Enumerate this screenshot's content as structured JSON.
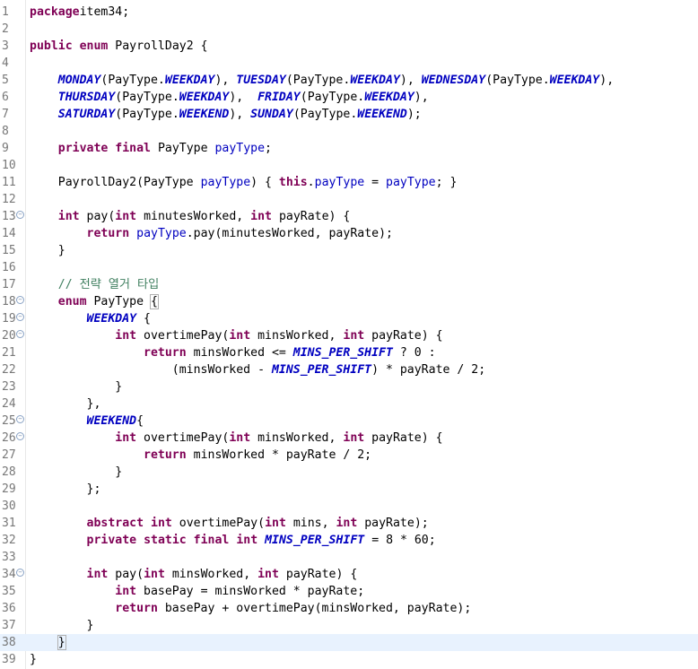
{
  "editor": {
    "language": "java",
    "current_line": 38,
    "colors": {
      "keyword": "#7f0055",
      "constant": "#0000c0",
      "field": "#0000c0",
      "comment": "#3f7f5f",
      "line_number": "#787878",
      "current_line_bg": "#e8f2fe"
    },
    "folding_markers_on_lines": [
      13,
      18,
      19,
      20,
      25,
      26,
      34
    ],
    "lines": [
      {
        "n": "1",
        "tokens": [
          [
            "kw",
            "package"
          ],
          [
            "",
            "item34;"
          ]
        ]
      },
      {
        "n": "2",
        "tokens": []
      },
      {
        "n": "3",
        "tokens": [
          [
            "kw",
            "public"
          ],
          [
            "",
            " "
          ],
          [
            "kw",
            "enum"
          ],
          [
            "",
            " PayrollDay2 {"
          ]
        ]
      },
      {
        "n": "4",
        "tokens": []
      },
      {
        "n": "5",
        "tokens": [
          [
            "",
            "    "
          ],
          [
            "cst",
            "MONDAY"
          ],
          [
            "",
            "(PayType."
          ],
          [
            "cst",
            "WEEKDAY"
          ],
          [
            "",
            "), "
          ],
          [
            "cst",
            "TUESDAY"
          ],
          [
            "",
            "(PayType."
          ],
          [
            "cst",
            "WEEKDAY"
          ],
          [
            "",
            "), "
          ],
          [
            "cst",
            "WEDNESDAY"
          ],
          [
            "",
            "(PayType."
          ],
          [
            "cst",
            "WEEKDAY"
          ],
          [
            "",
            "),"
          ]
        ]
      },
      {
        "n": "6",
        "tokens": [
          [
            "",
            "    "
          ],
          [
            "cst",
            "THURSDAY"
          ],
          [
            "",
            "(PayType."
          ],
          [
            "cst",
            "WEEKDAY"
          ],
          [
            "",
            "),  "
          ],
          [
            "cst",
            "FRIDAY"
          ],
          [
            "",
            "(PayType."
          ],
          [
            "cst",
            "WEEKDAY"
          ],
          [
            "",
            "),"
          ]
        ]
      },
      {
        "n": "7",
        "tokens": [
          [
            "",
            "    "
          ],
          [
            "cst",
            "SATURDAY"
          ],
          [
            "",
            "(PayType."
          ],
          [
            "cst",
            "WEEKEND"
          ],
          [
            "",
            "), "
          ],
          [
            "cst",
            "SUNDAY"
          ],
          [
            "",
            "(PayType."
          ],
          [
            "cst",
            "WEEKEND"
          ],
          [
            "",
            ");"
          ]
        ]
      },
      {
        "n": "8",
        "tokens": []
      },
      {
        "n": "9",
        "tokens": [
          [
            "",
            "    "
          ],
          [
            "kw",
            "private"
          ],
          [
            "",
            " "
          ],
          [
            "kw",
            "final"
          ],
          [
            "",
            " PayType "
          ],
          [
            "fld",
            "payType"
          ],
          [
            "",
            ";"
          ]
        ]
      },
      {
        "n": "10",
        "tokens": []
      },
      {
        "n": "11",
        "tokens": [
          [
            "",
            "    PayrollDay2(PayType "
          ],
          [
            "fld",
            "payType"
          ],
          [
            "",
            ") { "
          ],
          [
            "kw",
            "this"
          ],
          [
            "",
            "."
          ],
          [
            "fld",
            "payType"
          ],
          [
            "",
            " = "
          ],
          [
            "fld",
            "payType"
          ],
          [
            "",
            "; }"
          ]
        ]
      },
      {
        "n": "12",
        "tokens": []
      },
      {
        "n": "13",
        "tokens": [
          [
            "",
            "    "
          ],
          [
            "kw",
            "int"
          ],
          [
            "",
            " pay("
          ],
          [
            "kw",
            "int"
          ],
          [
            "",
            " minutesWorked, "
          ],
          [
            "kw",
            "int"
          ],
          [
            "",
            " payRate) {"
          ]
        ]
      },
      {
        "n": "14",
        "tokens": [
          [
            "",
            "        "
          ],
          [
            "kw",
            "return"
          ],
          [
            "",
            " "
          ],
          [
            "fld",
            "payType"
          ],
          [
            "",
            ".pay(minutesWorked, payRate);"
          ]
        ]
      },
      {
        "n": "15",
        "tokens": [
          [
            "",
            "    }"
          ]
        ]
      },
      {
        "n": "16",
        "tokens": []
      },
      {
        "n": "17",
        "tokens": [
          [
            "",
            "    "
          ],
          [
            "cmt",
            "// 전략 열거 타입"
          ]
        ]
      },
      {
        "n": "18",
        "tokens": [
          [
            "",
            "    "
          ],
          [
            "kw",
            "enum"
          ],
          [
            "",
            " PayType "
          ],
          [
            "br",
            "{"
          ]
        ]
      },
      {
        "n": "19",
        "tokens": [
          [
            "",
            "        "
          ],
          [
            "cst",
            "WEEKDAY"
          ],
          [
            "",
            " {"
          ]
        ]
      },
      {
        "n": "20",
        "tokens": [
          [
            "",
            "            "
          ],
          [
            "kw",
            "int"
          ],
          [
            "",
            " overtimePay("
          ],
          [
            "kw",
            "int"
          ],
          [
            "",
            " minsWorked, "
          ],
          [
            "kw",
            "int"
          ],
          [
            "",
            " payRate) {"
          ]
        ]
      },
      {
        "n": "21",
        "tokens": [
          [
            "",
            "                "
          ],
          [
            "kw",
            "return"
          ],
          [
            "",
            " minsWorked <= "
          ],
          [
            "cst",
            "MINS_PER_SHIFT"
          ],
          [
            "",
            " ? 0 :"
          ]
        ]
      },
      {
        "n": "22",
        "tokens": [
          [
            "",
            "                    (minsWorked - "
          ],
          [
            "cst",
            "MINS_PER_SHIFT"
          ],
          [
            "",
            ") * payRate / 2;"
          ]
        ]
      },
      {
        "n": "23",
        "tokens": [
          [
            "",
            "            }"
          ]
        ]
      },
      {
        "n": "24",
        "tokens": [
          [
            "",
            "        },"
          ]
        ]
      },
      {
        "n": "25",
        "tokens": [
          [
            "",
            "        "
          ],
          [
            "cst",
            "WEEKEND"
          ],
          [
            "",
            "{"
          ]
        ]
      },
      {
        "n": "26",
        "tokens": [
          [
            "",
            "            "
          ],
          [
            "kw",
            "int"
          ],
          [
            "",
            " overtimePay("
          ],
          [
            "kw",
            "int"
          ],
          [
            "",
            " minsWorked, "
          ],
          [
            "kw",
            "int"
          ],
          [
            "",
            " payRate) {"
          ]
        ]
      },
      {
        "n": "27",
        "tokens": [
          [
            "",
            "                "
          ],
          [
            "kw",
            "return"
          ],
          [
            "",
            " minsWorked * payRate / 2;"
          ]
        ]
      },
      {
        "n": "28",
        "tokens": [
          [
            "",
            "            }"
          ]
        ]
      },
      {
        "n": "29",
        "tokens": [
          [
            "",
            "        };"
          ]
        ]
      },
      {
        "n": "30",
        "tokens": []
      },
      {
        "n": "31",
        "tokens": [
          [
            "",
            "        "
          ],
          [
            "kw",
            "abstract"
          ],
          [
            "",
            " "
          ],
          [
            "kw",
            "int"
          ],
          [
            "",
            " overtimePay("
          ],
          [
            "kw",
            "int"
          ],
          [
            "",
            " mins, "
          ],
          [
            "kw",
            "int"
          ],
          [
            "",
            " payRate);"
          ]
        ]
      },
      {
        "n": "32",
        "tokens": [
          [
            "",
            "        "
          ],
          [
            "kw",
            "private"
          ],
          [
            "",
            " "
          ],
          [
            "kw",
            "static"
          ],
          [
            "",
            " "
          ],
          [
            "kw",
            "final"
          ],
          [
            "",
            " "
          ],
          [
            "kw",
            "int"
          ],
          [
            "",
            " "
          ],
          [
            "cst",
            "MINS_PER_SHIFT"
          ],
          [
            "",
            " = 8 * 60;"
          ]
        ]
      },
      {
        "n": "33",
        "tokens": []
      },
      {
        "n": "34",
        "tokens": [
          [
            "",
            "        "
          ],
          [
            "kw",
            "int"
          ],
          [
            "",
            " pay("
          ],
          [
            "kw",
            "int"
          ],
          [
            "",
            " minsWorked, "
          ],
          [
            "kw",
            "int"
          ],
          [
            "",
            " payRate) {"
          ]
        ]
      },
      {
        "n": "35",
        "tokens": [
          [
            "",
            "            "
          ],
          [
            "kw",
            "int"
          ],
          [
            "",
            " basePay = minsWorked * payRate;"
          ]
        ]
      },
      {
        "n": "36",
        "tokens": [
          [
            "",
            "            "
          ],
          [
            "kw",
            "return"
          ],
          [
            "",
            " basePay + overtimePay(minsWorked, payRate);"
          ]
        ]
      },
      {
        "n": "37",
        "tokens": [
          [
            "",
            "        }"
          ]
        ]
      },
      {
        "n": "38",
        "tokens": [
          [
            "",
            "    "
          ],
          [
            "br",
            "}"
          ],
          [
            "caret",
            ""
          ]
        ]
      },
      {
        "n": "39",
        "tokens": [
          [
            "",
            "}"
          ]
        ]
      }
    ]
  }
}
